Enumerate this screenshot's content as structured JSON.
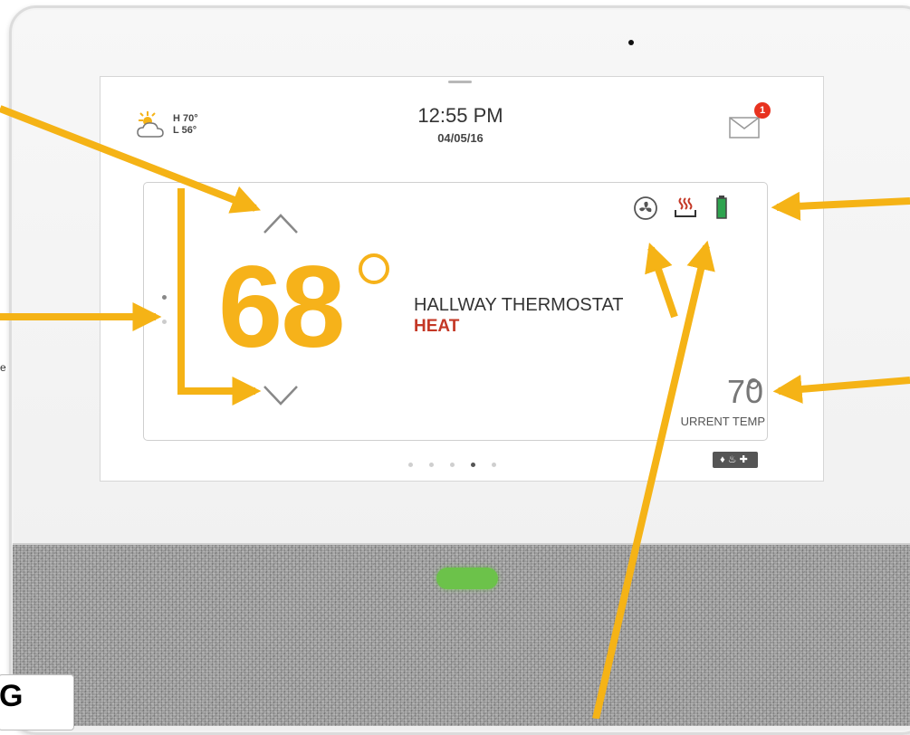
{
  "header": {
    "weather": {
      "icon": "partly-cloudy-icon",
      "high": "H 70°",
      "low": "L 56°"
    },
    "time": "12:55 PM",
    "date": "04/05/16",
    "messages": {
      "icon": "envelope-icon",
      "badge_count": "1"
    }
  },
  "thermostat": {
    "setpoint": "68",
    "name": "HALLWAY THERMOSTAT",
    "mode": "HEAT",
    "current_temp": "70",
    "current_temp_label": "URRENT TEMP",
    "status_icons": [
      "fan-icon",
      "heat-icon",
      "battery-icon"
    ]
  },
  "pagination": {
    "count": 5,
    "active_index": 3
  },
  "security_bar": {
    "icons": [
      "shield-icon",
      "fire-icon",
      "medical-plus-icon"
    ]
  },
  "colors": {
    "accent": "#f6b21a",
    "heat": "#c43826",
    "badge": "#e8321f",
    "battery": "#2ea44f",
    "led": "#6cc24a",
    "arrow": "#f5b316"
  },
  "side_text": "e",
  "corner_badge_glyph": "G"
}
